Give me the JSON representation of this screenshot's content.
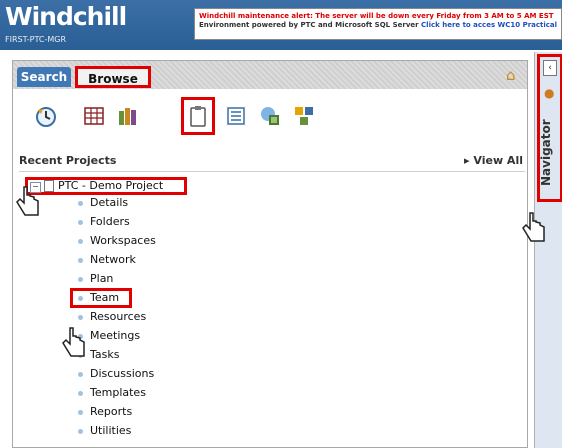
{
  "header": {
    "logo": "Windchill",
    "org": "FIRST-PTC-MGR",
    "alert_line1": "Windchill maintenance alert: The server will be down every Friday from 3 AM to 5 AM EST",
    "alert_line2_prefix": "Environment powered by PTC and Microsoft SQL Server",
    "alert_link": "Click here to acces WC10 Practical"
  },
  "tabs": {
    "search": "Search",
    "browse": "Browse"
  },
  "toolbar": {
    "icons": [
      "recent-clock-icon",
      "library-grid-icon",
      "products-books-icon",
      "projects-clipboard-icon",
      "list-icon",
      "sites-icon",
      "organizations-icon"
    ]
  },
  "content": {
    "section_title": "Recent Projects",
    "view_all": "View All",
    "project": "PTC - Demo Project",
    "items": [
      "Details",
      "Folders",
      "Workspaces",
      "Network",
      "Plan",
      "Team",
      "Resources",
      "Meetings",
      "Tasks",
      "Discussions",
      "Templates",
      "Reports",
      "Utilities"
    ]
  },
  "navigator": {
    "label": "Navigator"
  },
  "colors": {
    "header_blue": "#2a5f95",
    "highlight_red": "#e00000",
    "tab_blue": "#3f78b4"
  }
}
